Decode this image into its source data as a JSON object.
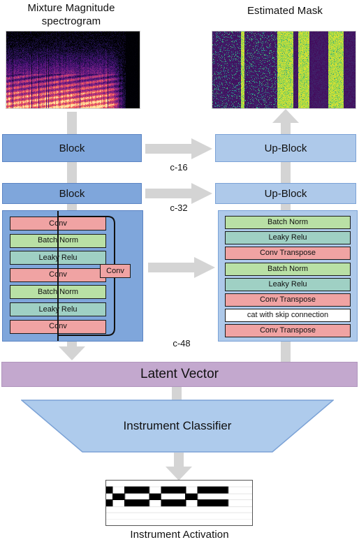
{
  "titles": {
    "mixture": "Mixture Magnitude\nspectrogram",
    "mixture_line1": "Mixture Magnitude",
    "mixture_line2": "spectrogram",
    "mask": "Estimated Mask",
    "activation": "Instrument Activation"
  },
  "encoder": {
    "block1_label": "Block",
    "block2_label": "Block",
    "detail_layers": [
      {
        "name": "Conv",
        "kind": "conv"
      },
      {
        "name": "Batch Norm",
        "kind": "bn"
      },
      {
        "name": "Leaky Relu",
        "kind": "lr"
      },
      {
        "name": "Conv",
        "kind": "conv"
      },
      {
        "name": "Batch Norm",
        "kind": "bn"
      },
      {
        "name": "Leaky Relu",
        "kind": "lr"
      },
      {
        "name": "Conv",
        "kind": "conv"
      }
    ],
    "skip_label": "Conv"
  },
  "decoder": {
    "upblock1_label": "Up-Block",
    "upblock2_label": "Up-Block",
    "detail_layers": [
      {
        "name": "Batch Norm",
        "kind": "bn"
      },
      {
        "name": "Leaky Relu",
        "kind": "lr"
      },
      {
        "name": "Conv Transpose",
        "kind": "conv"
      },
      {
        "name": "Batch Norm",
        "kind": "bn"
      },
      {
        "name": "Leaky Relu",
        "kind": "lr"
      },
      {
        "name": "Conv Transpose",
        "kind": "conv"
      },
      {
        "name": "cat with skip connection",
        "kind": "cat"
      },
      {
        "name": "Conv Transpose",
        "kind": "conv"
      }
    ]
  },
  "skip_labels": {
    "c16": "c-16",
    "c32": "c-32",
    "c48": "c-48"
  },
  "latent": {
    "label": "Latent Vector"
  },
  "classifier": {
    "label": "Instrument Classifier"
  },
  "colors": {
    "block": "#7fa6db",
    "upblock": "#aec9ea",
    "conv": "#f0a3a3",
    "batchnorm": "#b9e0a5",
    "leakyrelu": "#9fd0c4",
    "cat": "#ffffff",
    "latent": "#c3a8ce",
    "arrow": "#d4d4d4",
    "activation_on": "#000000",
    "activation_off": "#ffffff"
  },
  "activation_pattern": {
    "rows": 7,
    "cols": 24,
    "grid": [
      [
        0,
        0,
        0,
        0,
        0,
        0,
        0,
        0,
        0,
        0,
        0,
        0,
        0,
        0,
        0,
        0,
        0,
        0,
        0,
        0,
        0,
        0,
        0,
        0
      ],
      [
        1,
        0,
        0,
        1,
        1,
        1,
        1,
        0,
        0,
        1,
        1,
        1,
        1,
        0,
        0,
        1,
        1,
        1,
        1,
        1,
        0,
        0,
        0,
        0
      ],
      [
        0,
        1,
        1,
        0,
        0,
        0,
        0,
        1,
        1,
        0,
        0,
        0,
        0,
        1,
        1,
        0,
        0,
        0,
        0,
        0,
        0,
        0,
        0,
        0
      ],
      [
        1,
        0,
        0,
        1,
        1,
        1,
        1,
        0,
        0,
        1,
        1,
        1,
        1,
        0,
        0,
        1,
        1,
        1,
        1,
        1,
        0,
        0,
        0,
        0
      ],
      [
        0,
        0,
        0,
        0,
        0,
        0,
        0,
        0,
        0,
        0,
        0,
        0,
        0,
        0,
        0,
        0,
        0,
        0,
        0,
        0,
        0,
        0,
        0,
        0
      ],
      [
        0,
        0,
        0,
        0,
        0,
        0,
        0,
        0,
        0,
        0,
        0,
        0,
        0,
        0,
        0,
        0,
        0,
        0,
        0,
        0,
        0,
        0,
        0,
        0
      ],
      [
        0,
        0,
        0,
        0,
        0,
        0,
        0,
        0,
        0,
        0,
        0,
        0,
        0,
        0,
        0,
        0,
        0,
        0,
        0,
        0,
        0,
        0,
        0,
        0
      ]
    ]
  }
}
